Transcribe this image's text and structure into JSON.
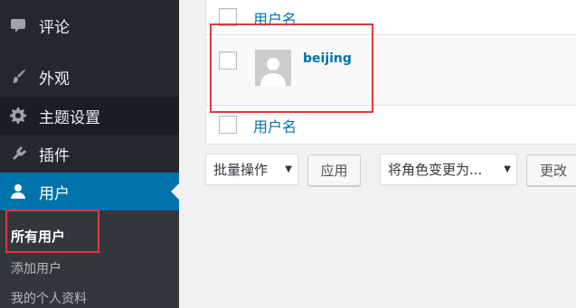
{
  "sidebar": {
    "items": [
      {
        "label": "评论",
        "icon": "comment-icon"
      },
      {
        "label": "外观",
        "icon": "paintbrush-icon"
      },
      {
        "label": "主题设置",
        "icon": "gear-icon"
      },
      {
        "label": "插件",
        "icon": "plugin-icon"
      },
      {
        "label": "用户",
        "icon": "user-icon"
      }
    ],
    "submenu": [
      "所有用户",
      "添加用户",
      "我的个人资料"
    ]
  },
  "table": {
    "column_header": "用户名",
    "column_footer": "用户名",
    "rows": [
      {
        "username": "beijing",
        "avatar": "default-avatar-icon"
      }
    ]
  },
  "bulk": {
    "action_select": "批量操作",
    "apply_button": "应用",
    "role_select": "将角色变更为...",
    "change_button": "更改"
  },
  "colors": {
    "sidebar_bg": "#23282d",
    "accent": "#0073aa",
    "annotation": "#e0393e"
  }
}
